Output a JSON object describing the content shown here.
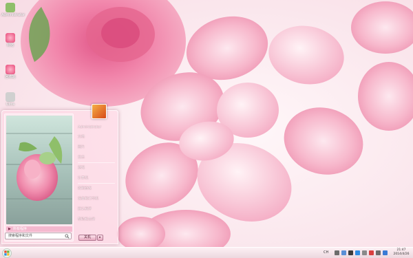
{
  "desktop": {
    "icons": [
      {
        "label": "Administrator",
        "icon": "user-folder-icon",
        "color": "#8fbf6a"
      },
      {
        "label": "网络",
        "icon": "network-icon",
        "color": "#e84a7a"
      },
      {
        "label": "回收站",
        "icon": "recycle-bin-icon",
        "color": "#e84a7a"
      },
      {
        "label": "Ultra",
        "icon": "shortcut-icon",
        "color": "#d0d0d0"
      }
    ]
  },
  "start_menu": {
    "all_programs": "所有程序",
    "search_placeholder": "搜索程序和文件",
    "user_name": "Administrator",
    "right_items": [
      "文档",
      "图片",
      "音乐",
      "游戏",
      "计算机",
      "控制面板",
      "设备和打印机",
      "默认程序",
      "帮助和支持"
    ],
    "shutdown_label": "关机",
    "shutdown_arrow": "▸"
  },
  "taskbar": {
    "start_icon": "windows-orb-icon",
    "tray_lang": "CH",
    "clock_time": "21:47",
    "clock_date": "2014/4/26"
  },
  "colors": {
    "accent": "#f4b9cf",
    "menu_tint": "#ffd6e4",
    "rose_pink": "#f48fb1"
  }
}
